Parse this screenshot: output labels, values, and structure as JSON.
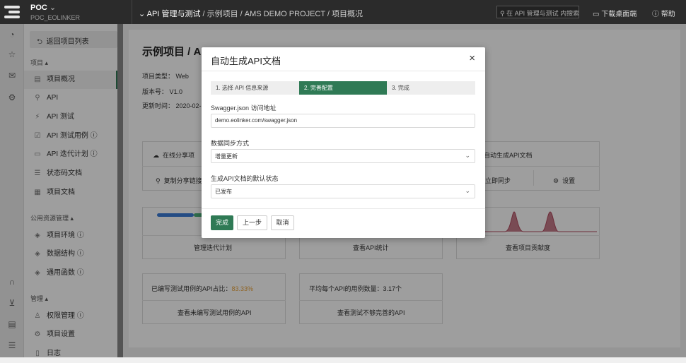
{
  "topbar": {
    "project_name": "POC",
    "project_chevron": "⌄",
    "project_sub": "POC_EOLINKER",
    "nav_prefix": "⌄ API 管理与测试",
    "breadcrumb": " / 示例项目 / AMS DEMO PROJECT / 项目概况",
    "search_placeholder": "在 API 管理与测试 内搜索",
    "download_label": "下载桌面端",
    "help_label": "帮助"
  },
  "iconrail": {
    "icons": [
      "bell-icon",
      "star-icon",
      "mail-icon",
      "gear-icon",
      "headset-icon",
      "collapse-icon",
      "keyboard-icon",
      "menu-icon"
    ]
  },
  "sidebar": {
    "back_label": "返回项目列表",
    "group_project": "项目 ▴",
    "group_public": "公用资源管理 ▴",
    "group_manage": "管理 ▴",
    "items": [
      {
        "label": "项目概况",
        "icon": "▤"
      },
      {
        "label": "API",
        "icon": "⚲"
      },
      {
        "label": "API 测试",
        "icon": "⚡"
      },
      {
        "label": "API 测试用例 ⓘ",
        "icon": "☑"
      },
      {
        "label": "API 迭代计划 ⓘ",
        "icon": "▭"
      },
      {
        "label": "状态码文档",
        "icon": "☰"
      },
      {
        "label": "项目文档",
        "icon": "▦"
      },
      {
        "label": "项目环境 ⓘ",
        "icon": "◈"
      },
      {
        "label": "数据结构 ⓘ",
        "icon": "◈"
      },
      {
        "label": "通用函数 ⓘ",
        "icon": "◈"
      },
      {
        "label": "权限管理 ⓘ",
        "icon": "♙"
      },
      {
        "label": "项目设置",
        "icon": "⚙"
      },
      {
        "label": "日志",
        "icon": "▯"
      }
    ]
  },
  "main": {
    "title": "示例项目 / AMS DEMO PROJECT",
    "type_label": "项目类型：",
    "type_value": "Web",
    "version_label": "版本号：",
    "version_value": "V1.0",
    "updated_label": "更新时间：",
    "updated_value": "2020-02-",
    "share_online": "在线分享项",
    "copy_share_link": "复制分享链接",
    "auto_gen_doc": "自动生成API文档",
    "sync_now": "立即同步",
    "settings": "设置",
    "card_iteration": "管理迭代计划",
    "card_api_stats": "查看API统计",
    "card_contrib": "查看项目贡献度",
    "written_ratio_label": "已编写测试用例的API占比：",
    "written_ratio_value": "83.33%",
    "avg_cases_label": "平均每个API的用例数量：",
    "avg_cases_value": "3.17个",
    "view_unwritten": "查看未编写测试用例的API",
    "view_incomplete": "查看测试不够完善的API"
  },
  "modal": {
    "title": "自动生成API文档",
    "close": "×",
    "steps": [
      "1. 选择 API 信息来源",
      "2. 完善配置",
      "3. 完成"
    ],
    "active_step": 2,
    "swagger_label": "Swagger.json 访问地址",
    "swagger_value": "demo.eolinker.com/swagger.json",
    "sync_label": "数据同步方式",
    "sync_value": "增量更新",
    "status_label": "生成API文档的默认状态",
    "status_value": "已发布",
    "btn_done": "完成",
    "btn_prev": "上一步",
    "btn_cancel": "取消"
  },
  "colors": {
    "accent": "#2f7a55",
    "topbar": "#2b2b2b",
    "ratio": "#e8a33d",
    "chart_peak": "#b04a5e",
    "progress_blue": "#3a7bd5",
    "progress_green": "#4caf7a"
  }
}
